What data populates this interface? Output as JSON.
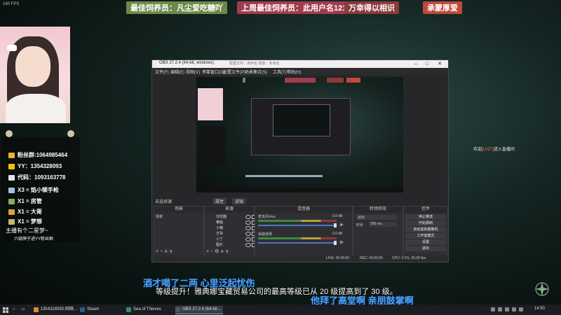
{
  "stream": {
    "fps_label": "160 FPS",
    "banners": [
      "最佳饲养员：凡尘爱吃糖吖",
      "上周最佳饲养员：此用户名1219",
      "万幸得以相识",
      "承蒙厚爱"
    ],
    "panel": {
      "rows": [
        {
          "icon": "qq-icon",
          "color": "#f0b429",
          "text": "粉丝群:1064985464"
        },
        {
          "icon": "yy-icon",
          "color": "#f2c200",
          "text": "YY：1354328093"
        },
        {
          "icon": "phone-icon",
          "color": "#e2e2e2",
          "text": "代码：1093163778"
        },
        {
          "icon": "horn-icon",
          "color": "#9fc3e6",
          "text": "X3 = 焰小顿手枪"
        },
        {
          "icon": "gift-icon",
          "color": "#7db35a",
          "text": "X1 = 房管"
        },
        {
          "icon": "gift-icon",
          "color": "#d9a441",
          "text": "X1 = 大哥"
        },
        {
          "icon": "gift-icon",
          "color": "#c9b66b",
          "text": "X1 = 梦想"
        }
      ],
      "footer1": "主播有个二星梦~",
      "footer2": "六级牌子进YY粉丝群"
    },
    "entry_notice": {
      "prefix": "欢迎",
      "name": "[LV27]",
      "suffix": "进入直播间"
    },
    "lyric": "酒才喝了二两 心里泛起忧伤",
    "level_up": "等级提升！雅典娜宝藏贸易公司的最高等级已从 20 级提高到了 30 级。",
    "thanks": "他拜了高堂啊 亲朋鼓掌啊"
  },
  "obs": {
    "title": "OBS 27.2.4 (64-bit, windows)",
    "title_hint": "配置文件：未命名 场景：未命名",
    "menu": [
      "文件(F)",
      "编辑(E)",
      "视图(V)",
      "停靠窗口(D)",
      "配置文件(P)",
      "场景集合(S)",
      "工具(T)",
      "帮助(H)"
    ],
    "no_source": "未选择源",
    "attr_btn": "属性",
    "filter_btn": "滤镜",
    "scenes_header": "场景",
    "scene_item": "场景",
    "sources_header": "来源",
    "sources": [
      "浏览器",
      "横幅",
      "小猪",
      "方块",
      "小丁",
      "图片"
    ],
    "mixer_header": "混音器",
    "mixer_tracks": [
      {
        "name": "麦克风/Aux",
        "db": "0.0 dB"
      },
      {
        "name": "桌面音频",
        "db": "0.0 dB"
      }
    ],
    "transitions_header": "转场特效",
    "transition_value": "淡出",
    "duration_label": "时长",
    "duration_value": "300 ms",
    "controls_header": "控件",
    "controls": [
      "停止推流",
      "开始录制",
      "启动虚拟摄像机",
      "工作室模式",
      "设置",
      "退出"
    ],
    "status": [
      "LIVE: 00:00:00",
      "REC: 00:00:00",
      "CPU: 3.1%, 30.00 fps"
    ]
  },
  "taskbar": {
    "items": [
      {
        "label": "1354328093-网络...",
        "color": "#d98c2b",
        "active": false
      },
      {
        "label": "Steam",
        "color": "#2a5a8a",
        "active": false
      },
      {
        "label": "Sea of Thieves",
        "color": "#3a8a6a",
        "active": false
      },
      {
        "label": "OBS 27.2.4 (64-bit...",
        "color": "#555555",
        "active": true
      }
    ],
    "clock": "14:50"
  }
}
